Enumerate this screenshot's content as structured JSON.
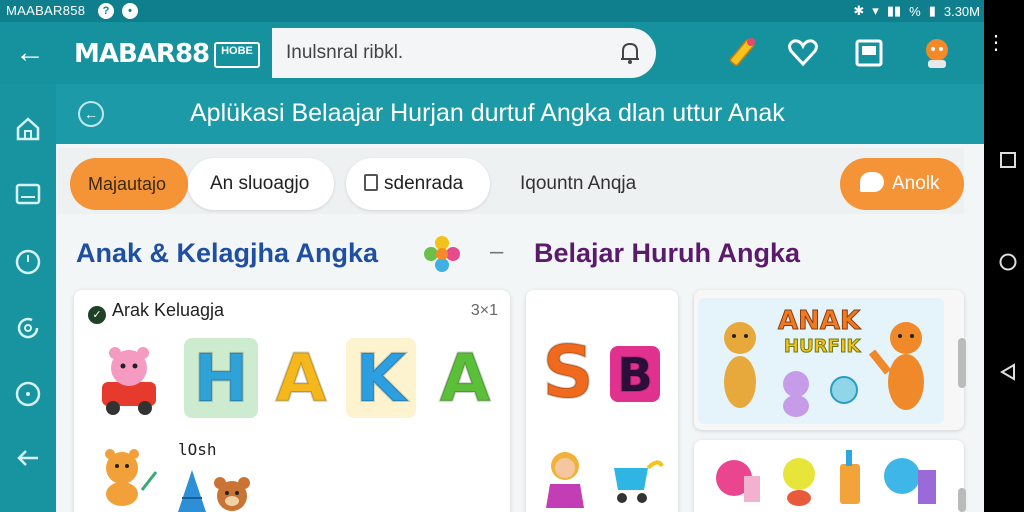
{
  "status_bar": {
    "app_label": "MAABAR858",
    "time": "3.30M",
    "battery": "%"
  },
  "app_bar": {
    "brand": "MABAR88",
    "brand_badge": "HOBE",
    "search_value": "Inulsnral ribkl.",
    "icons": [
      "back-arrow-icon",
      "pencil-icon",
      "heart-icon",
      "book-icon",
      "profile-icon"
    ]
  },
  "nav_rail": {
    "icons": [
      "home-icon",
      "tablet-icon",
      "clock-icon",
      "refresh-icon",
      "circle-icon",
      "back-icon"
    ]
  },
  "banner": {
    "title": "Aplükasi Belaajar Hurjan durtuf Angka dlan uttur Anak"
  },
  "tabs": [
    {
      "label": "Majautajo",
      "style": "orange"
    },
    {
      "label": "An sluoagjo",
      "style": "white"
    },
    {
      "label": "sdenrada",
      "style": "white"
    },
    {
      "label": "Iqountn Anqja",
      "style": "plain"
    },
    {
      "label": "Anolk",
      "style": "orange"
    }
  ],
  "sections": {
    "left_heading": "Anak & Kelagjha Angka",
    "separator": "–",
    "right_heading": "Belajar Huruh Angka"
  },
  "card_main": {
    "title": "Arak Keluagja",
    "count": "3×1",
    "letters": [
      {
        "char": "H",
        "color": "#2fa2d8",
        "tile": "#cdebcf"
      },
      {
        "char": "A",
        "color": "#f5b81c",
        "tile": "#ffffff"
      },
      {
        "char": "K",
        "color": "#2c9fe0",
        "tile": "#fdf3cf"
      },
      {
        "char": "A",
        "color": "#5cbf3a",
        "tile": "#ffffff"
      }
    ],
    "scribble": "lOsh"
  },
  "card_middle": {
    "letters": [
      {
        "char": "S",
        "color": "#f06a1e"
      },
      {
        "char": "B",
        "color": "#e0318f"
      }
    ]
  },
  "card_right": {
    "poster_line1": "ANAK",
    "poster_line2": "HURFIK",
    "colors": {
      "line1": "#f07a1f",
      "line2": "#f5c21b"
    }
  },
  "colors": {
    "teal_dark": "#0f7f8d",
    "teal": "#16929f",
    "orange": "#f49436",
    "heading_blue": "#1f4fa1",
    "heading_purple": "#5c1a6d"
  }
}
